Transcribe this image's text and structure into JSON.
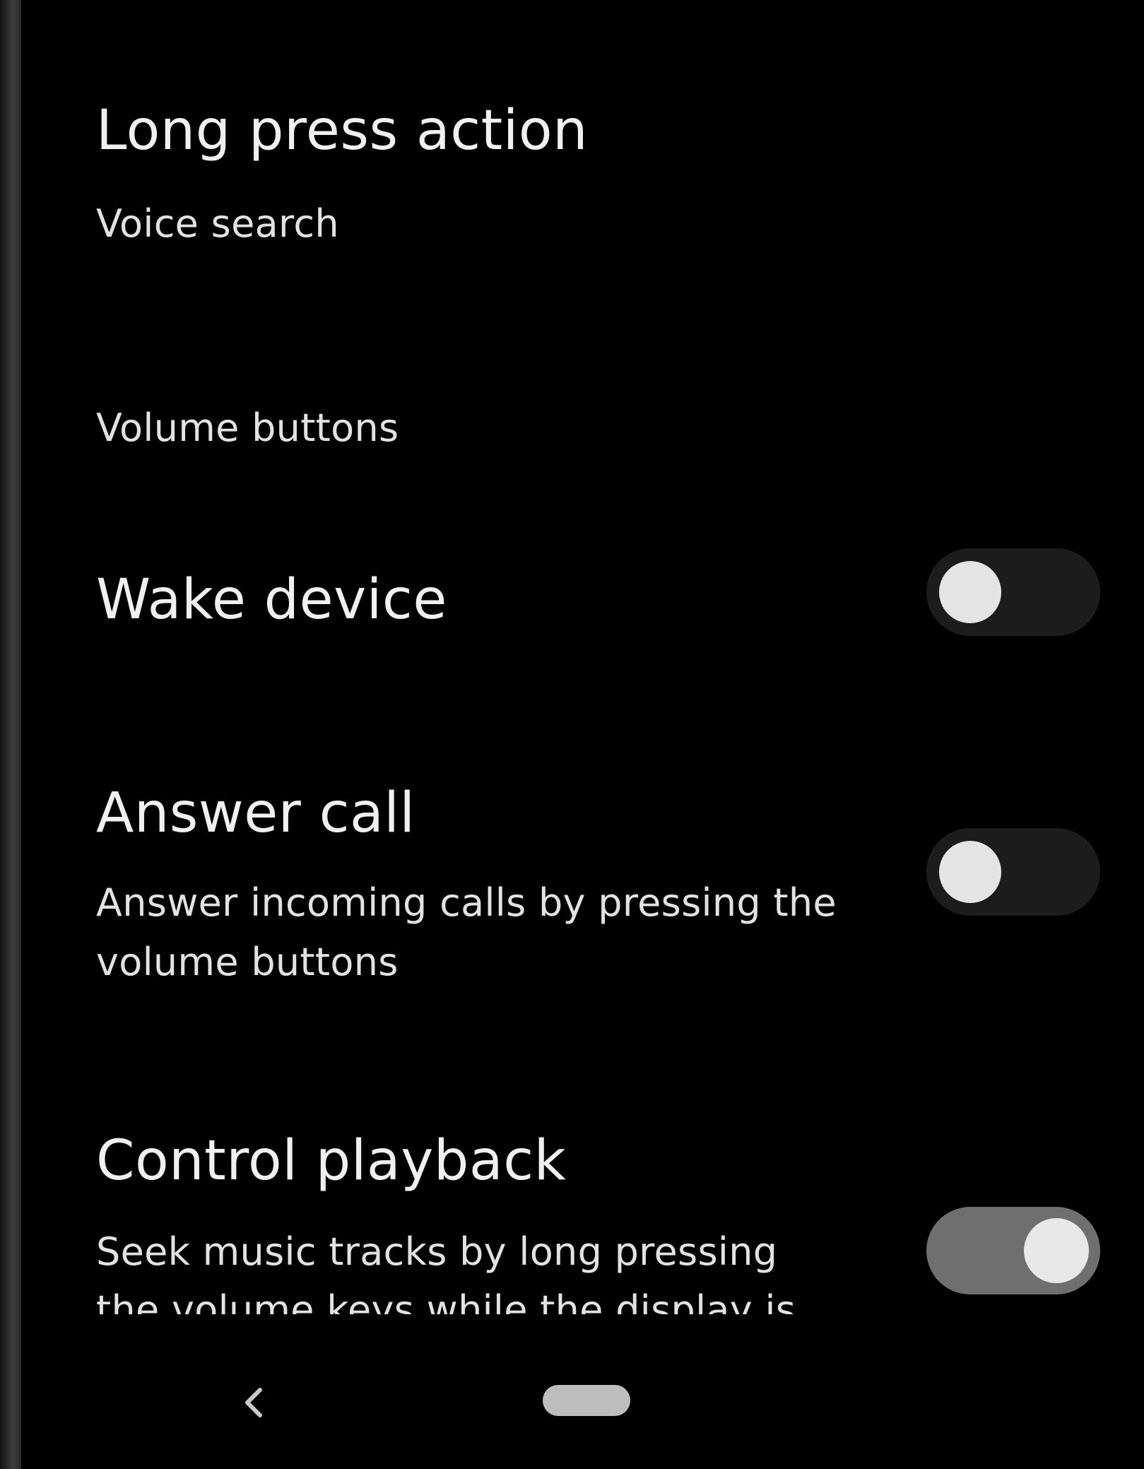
{
  "settings": {
    "long_press": {
      "title": "Long press action",
      "summary": "Voice search"
    },
    "volume_category": "Volume buttons",
    "wake_device": {
      "title": "Wake device",
      "enabled": false
    },
    "answer_call": {
      "title": "Answer call",
      "summary_line1": "Answer incoming calls by pressing the",
      "summary_line2": "volume buttons",
      "enabled": false
    },
    "control_playback": {
      "title": "Control playback",
      "summary_line1": "Seek music tracks by long pressing",
      "summary_line2": "the volume keys while the display is",
      "enabled": true
    }
  },
  "nav_bar": {
    "back_icon": "chevron-left-icon",
    "home_icon": "home-pill-icon"
  },
  "colors": {
    "background": "#000000",
    "text": "#e6e6e6",
    "toggle_off_track": "#1c1c1c",
    "toggle_on_track": "#6f6f6f",
    "thumb": "#e4e4e4"
  }
}
